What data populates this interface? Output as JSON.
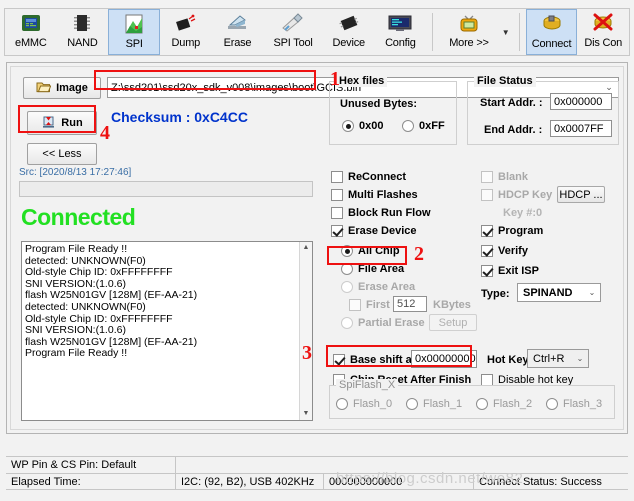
{
  "toolbar": {
    "items": [
      {
        "label": "eMMC",
        "icon": "emmc-chip-icon",
        "selected": false
      },
      {
        "label": "NAND",
        "icon": "nand-chip-icon",
        "selected": false
      },
      {
        "label": "SPI",
        "icon": "spi-chip-icon",
        "selected": true
      },
      {
        "label": "Dump",
        "icon": "dump-icon",
        "selected": false
      },
      {
        "label": "Erase",
        "icon": "erase-icon",
        "selected": false
      },
      {
        "label": "SPI Tool",
        "icon": "spi-tool-icon",
        "selected": false
      },
      {
        "label": "Device",
        "icon": "device-icon",
        "selected": false
      },
      {
        "label": "Config",
        "icon": "config-monitor-icon",
        "selected": false
      }
    ],
    "more_label": "More >>",
    "more_icon": "more-tv-icon",
    "connect_label": "Connect",
    "connect_icon": "connect-plug-icon",
    "disconnect_label": "Dis Con",
    "disconnect_icon": "disconnect-icon"
  },
  "main": {
    "image_button": "Image",
    "image_icon": "open-folder-icon",
    "run_button": "Run",
    "run_icon": "run-hourglass-icon",
    "less_button": "<< Less",
    "file_path": "Z:\\ssd201\\ssd20x_sdk_v008\\images\\boot\\GCIS.bin",
    "checksum": "Checksum : 0xC4CC",
    "src_line": "Src: [2020/8/13 17:27:46]",
    "connected_text": "Connected",
    "log_lines": [
      "Program File Ready !!",
      "detected: UNKNOWN(F0)",
      "Old-style Chip ID: 0xFFFFFFFF",
      "SNI VERSION:(1.0.6)",
      "flash W25N01GV [128M] (EF-AA-21)",
      "detected: UNKNOWN(F0)",
      "Old-style Chip ID: 0xFFFFFFFF",
      "SNI VERSION:(1.0.6)",
      "flash W25N01GV [128M] (EF-AA-21)",
      "Program File Ready !!"
    ]
  },
  "hex_files": {
    "title": "Hex files",
    "unused_bytes_label": "Unused Bytes:",
    "option_00": "0x00",
    "option_ff": "0xFF",
    "selected": "0x00"
  },
  "file_status": {
    "title": "File Status",
    "start_label": "Start Addr. :",
    "start_value": "0x000000",
    "end_label": "End Addr. :",
    "end_value": "0x0007FF"
  },
  "options_left": [
    {
      "label": "ReConnect",
      "checked": false,
      "disabled": false
    },
    {
      "label": "Multi Flashes",
      "checked": false,
      "disabled": false
    },
    {
      "label": "Block Run Flow",
      "checked": false,
      "disabled": false
    },
    {
      "label": "Erase Device",
      "checked": true,
      "disabled": false
    }
  ],
  "erase_radios": [
    {
      "label": "All Chip",
      "checked": true,
      "disabled": false
    },
    {
      "label": "File Area",
      "checked": false,
      "disabled": false
    },
    {
      "label": "Erase Area",
      "checked": false,
      "disabled": true
    },
    {
      "label": "Partial Erase",
      "checked": false,
      "disabled": true
    }
  ],
  "first_kbytes": {
    "label": "First",
    "value": "512",
    "unit": "KBytes",
    "checked": false,
    "disabled": true
  },
  "setup_button": "Setup",
  "options_right": [
    {
      "label": "Blank",
      "checked": false,
      "disabled": true
    },
    {
      "label": "HDCP Key",
      "checked": false,
      "disabled": true
    },
    {
      "label": "Program",
      "checked": true,
      "disabled": false
    },
    {
      "label": "Verify",
      "checked": true,
      "disabled": false
    },
    {
      "label": "Exit ISP",
      "checked": true,
      "disabled": false
    }
  ],
  "hdcp_button": "HDCP ...",
  "key_num_label": "Key #:0",
  "type": {
    "label": "Type:",
    "value": "SPINAND"
  },
  "base_shift": {
    "label": "Base shift at",
    "value": "0x00000000",
    "checked": true
  },
  "chip_reset": {
    "label": "Chip Reset After Finish",
    "checked": false
  },
  "hot_key": {
    "label": "Hot Key",
    "value": "Ctrl+R"
  },
  "disable_hot_key": {
    "label": "Disable hot key",
    "checked": false
  },
  "spiflash": {
    "title": "SpiFlash_X",
    "options": [
      "Flash_0",
      "Flash_1",
      "Flash_2",
      "Flash_3"
    ],
    "selected": null
  },
  "annotations": [
    {
      "number": "1"
    },
    {
      "number": "2"
    },
    {
      "number": "3"
    },
    {
      "number": "4"
    }
  ],
  "status_bar": {
    "wp_cs": "WP Pin & CS Pin: Default",
    "elapsed_label": "Elapsed Time:",
    "i2c_usb": "I2C: (92, B2), USB  402KHz",
    "counter": "000000000000",
    "connect_status": "Connect Status: Success"
  },
  "watermark": "https://blog.csdn.net/we82",
  "colors": {
    "accent_blue": "#0033cc",
    "connected_green": "#22e022",
    "annotation_red": "#ee1111",
    "selected_tab": "#cde0f5"
  }
}
